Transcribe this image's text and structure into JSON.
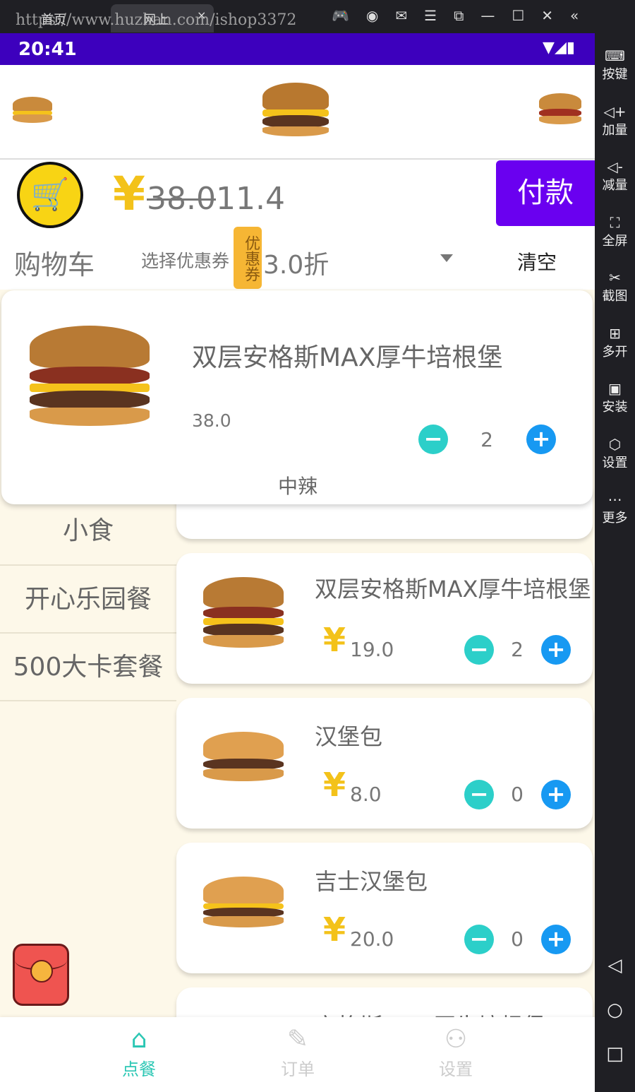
{
  "browser": {
    "url_overlay": "https://www.huzhan.com/ishop3372",
    "home_label": "首页",
    "tab_label": "网上"
  },
  "status": {
    "time": "20:41"
  },
  "cart": {
    "currency": "¥",
    "original_price": "38.0",
    "discounted_price": "11.4",
    "pay_label": "付款",
    "cart_label": "购物车",
    "coupon_select_label": "选择优惠券",
    "coupon_badge": "优惠券",
    "discount": "3.0折",
    "clear_label": "清空"
  },
  "popup_item": {
    "name": "双层安格斯MAX厚牛培根堡",
    "price": "38.0",
    "qty": "2",
    "spice": "中辣"
  },
  "categories": [
    {
      "label": "小食"
    },
    {
      "label": "开心乐园餐"
    },
    {
      "label": "500大卡套餐"
    }
  ],
  "products": [
    {
      "name": "双层安格斯MAX厚牛培根堡",
      "price": "19.0",
      "qty": "2"
    },
    {
      "name": "汉堡包",
      "price": "8.0",
      "qty": "0"
    },
    {
      "name": "吉士汉堡包",
      "price": "20.0",
      "qty": "0"
    },
    {
      "name": "安格斯MAX厚牛培根堡",
      "price": "",
      "qty": ""
    }
  ],
  "nav": [
    {
      "label": "点餐",
      "icon": "home-icon",
      "active": true
    },
    {
      "label": "订单",
      "icon": "order-icon"
    },
    {
      "label": "设置",
      "icon": "user-settings-icon"
    }
  ],
  "emulator_sidebar": [
    {
      "label": "按键"
    },
    {
      "label": "加量"
    },
    {
      "label": "减量"
    },
    {
      "label": "全屏"
    },
    {
      "label": "截图"
    },
    {
      "label": "多开"
    },
    {
      "label": "安装"
    },
    {
      "label": "设置"
    },
    {
      "label": "更多"
    }
  ],
  "colors": {
    "status": "#3d00bd",
    "pay": "#6a00f0",
    "accent": "#2ccfc9",
    "plus": "#1799f2",
    "yen": "#f3c21a"
  }
}
